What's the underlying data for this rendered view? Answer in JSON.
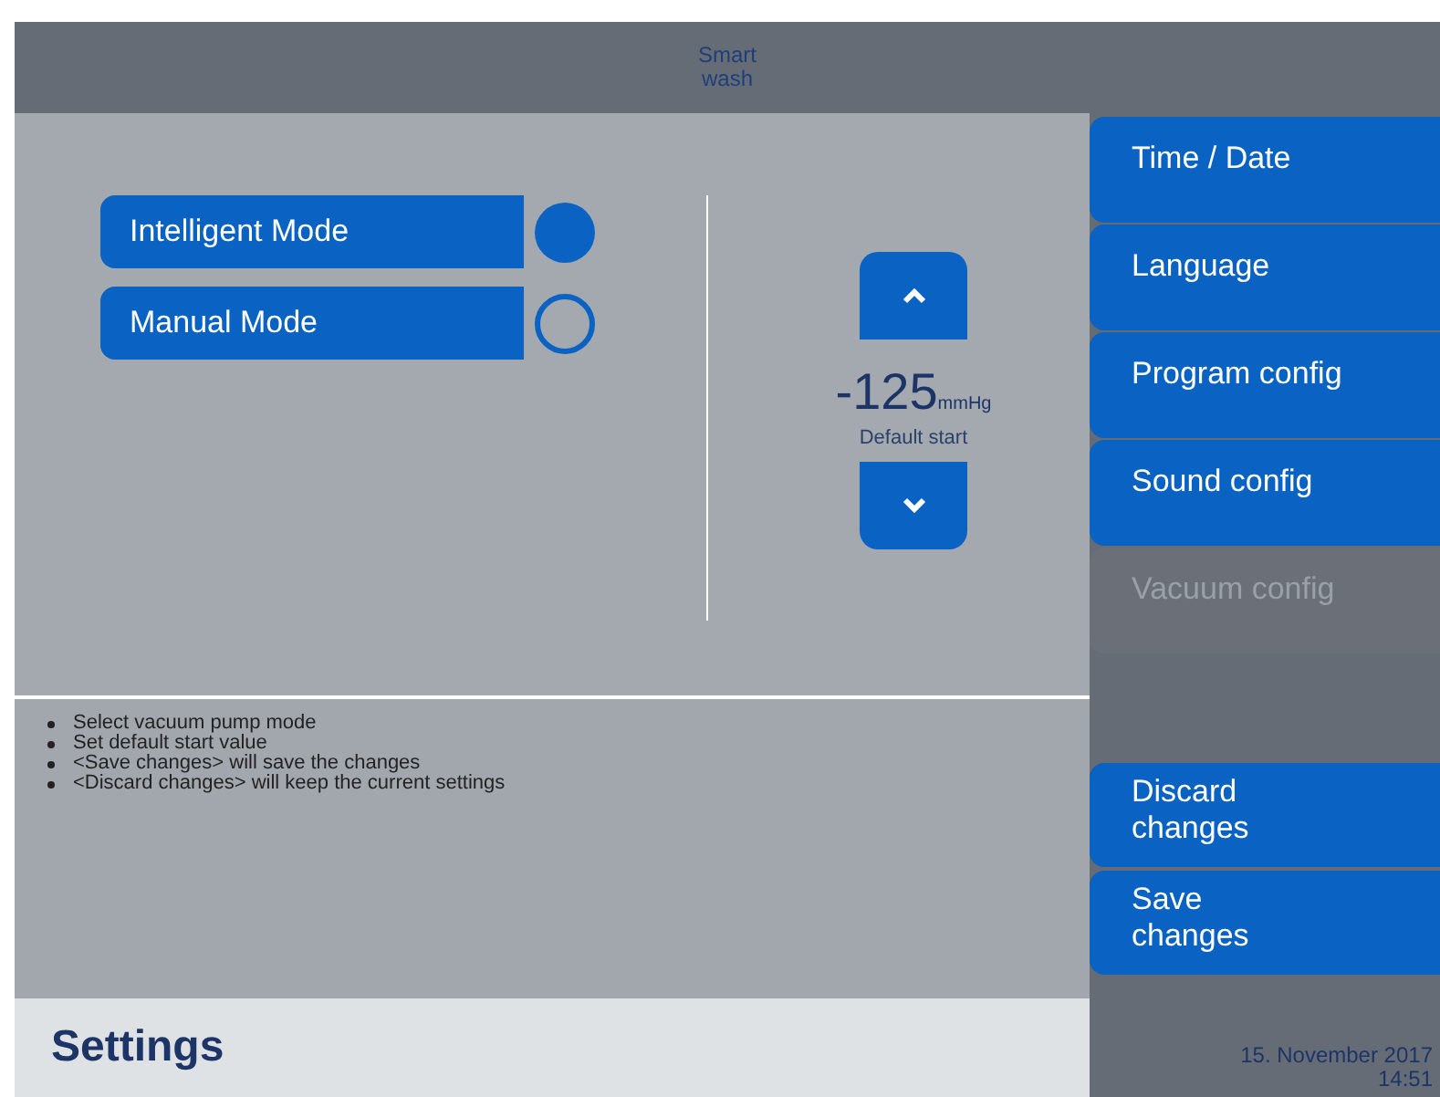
{
  "header": {
    "title": "Smart wash"
  },
  "modes": [
    {
      "label": "Intelligent Mode",
      "selected": true
    },
    {
      "label": "Manual Mode",
      "selected": false
    }
  ],
  "vacuum": {
    "value": "-125",
    "unit": "mmHg",
    "caption": "Default start"
  },
  "hints": [
    "Select vacuum pump mode",
    "Set default start value",
    "<Save changes> will save the changes",
    "<Discard changes> will keep the current settings"
  ],
  "page_title": "Settings",
  "menu": [
    {
      "label": "Time / Date",
      "disabled": false
    },
    {
      "label": "Language",
      "disabled": false
    },
    {
      "label": "Program config",
      "disabled": false
    },
    {
      "label": "Sound config",
      "disabled": false
    },
    {
      "label": "Vacuum config",
      "disabled": true
    }
  ],
  "actions": [
    "Discard changes",
    "Save changes"
  ],
  "status": {
    "date": "15. November 2017",
    "time": "14:51"
  }
}
